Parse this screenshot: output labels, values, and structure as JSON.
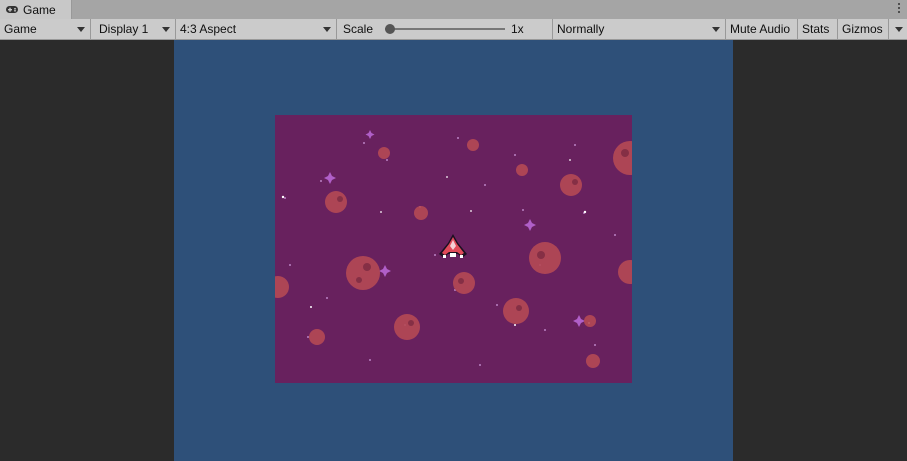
{
  "window": {
    "tab_title": "Game",
    "tab_icon": "gamepad-icon",
    "menu_icon": "kebab-menu-icon"
  },
  "toolbar": {
    "view_mode": "Game",
    "display": "Display 1",
    "aspect": "4:3 Aspect",
    "scale_label": "Scale",
    "scale_value": "1x",
    "scale_fraction": 0,
    "play_focus": "Normally",
    "mute_audio": "Mute Audio",
    "stats": "Stats",
    "gizmos": "Gizmos"
  },
  "colors": {
    "letterbox": "#2e5079",
    "space_background": "#68215e",
    "asteroid": "#b54a55",
    "ship": "#e04a5a"
  }
}
